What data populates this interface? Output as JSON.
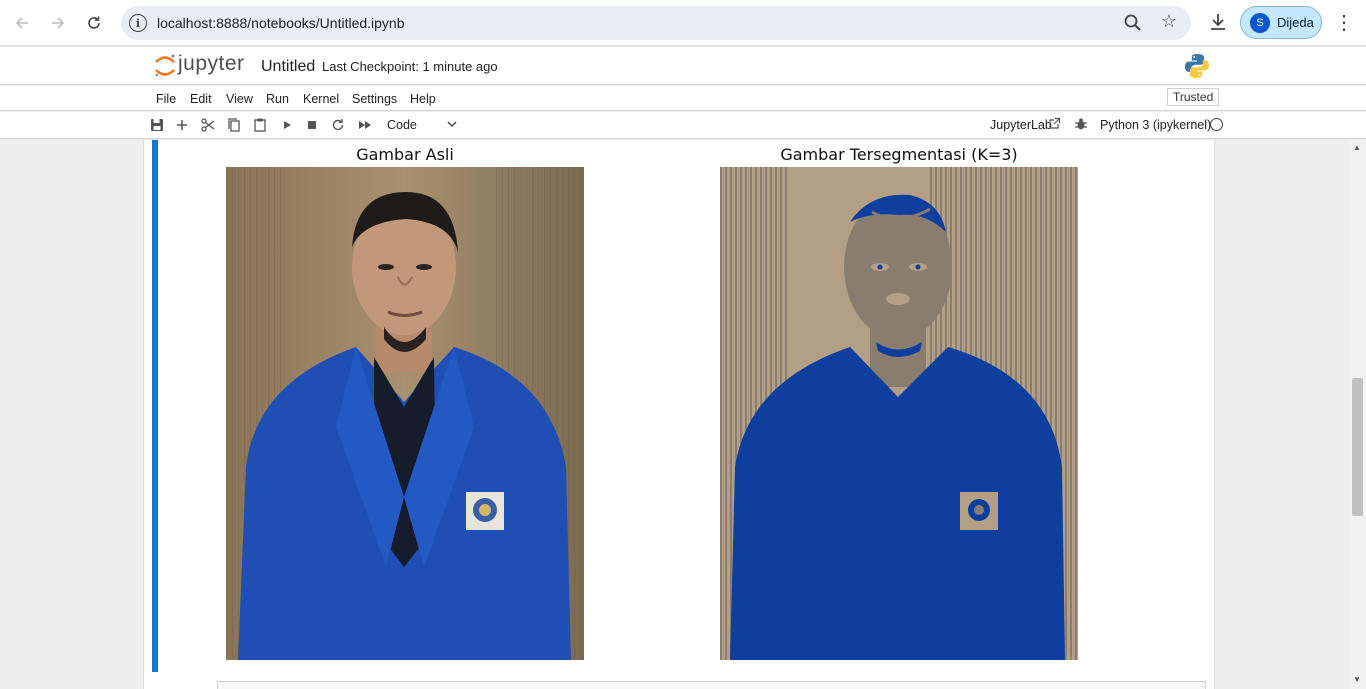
{
  "browser": {
    "url": "localhost:8888/notebooks/Untitled.ipynb",
    "profile_initial": "S",
    "profile_name": "Dijeda"
  },
  "jupyter": {
    "logo_text": "jupyter",
    "notebook_title": "Untitled",
    "checkpoint": "Last Checkpoint: 1 minute ago",
    "trusted": "Trusted",
    "menu": [
      "File",
      "Edit",
      "View",
      "Run",
      "Kernel",
      "Settings",
      "Help"
    ],
    "cell_type": "Code",
    "jupyterlab_link": "JupyterLab",
    "kernel_name": "Python 3 (ipykernel)"
  },
  "output": {
    "left_title": "Gambar Asli",
    "right_title": "Gambar Tersegmentasi (K=3)"
  },
  "colors": {
    "cell_selected": "#1976d2",
    "segment_blue": "#0f3f9e",
    "segment_gray": "#8a7d70",
    "segment_tan": "#b29f86"
  }
}
